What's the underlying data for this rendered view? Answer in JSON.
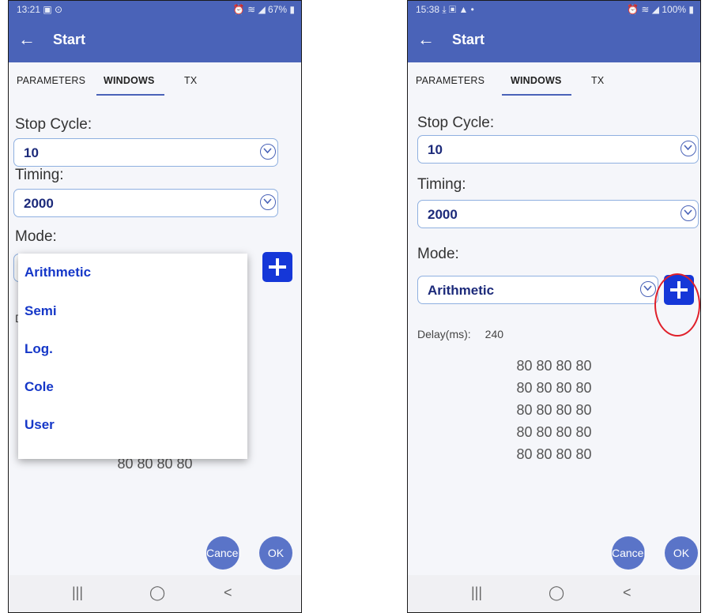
{
  "left": {
    "status_time": "13:21 ▣ ⊙",
    "status_right": "⏰ ≋ ◢ 67% ▮",
    "menu_items": [
      "Arithmetic",
      "Semi",
      "Log.",
      "Cole",
      "User"
    ],
    "delay_label": "D",
    "rows": [
      "80 80 80 80"
    ]
  },
  "right": {
    "status_time": "15:38 ⤓ ▣ ▲ •",
    "status_right": "⏰ ≋ ◢ 100% ▮",
    "delay_label": "Delay(ms):",
    "delay_value": "240",
    "rows": [
      "80 80 80 80",
      "80 80 80 80",
      "80 80 80 80",
      "80 80 80 80",
      "80 80 80 80"
    ]
  },
  "app": {
    "title": "Start",
    "tabs": [
      "PARAMETERS",
      "WINDOWS",
      "TX"
    ],
    "stop_cycle_label": "Stop Cycle:",
    "stop_cycle_value": "10",
    "timing_label": "Timing:",
    "timing_value": "2000",
    "mode_label": "Mode:",
    "mode_value": "Arithmetic",
    "cancel_label": "Cancel",
    "ok_label": "OK"
  },
  "colors": {
    "appbar": "#4a63b8",
    "accent_blue": "#1537d8",
    "highlight_circle": "#e0202a"
  }
}
